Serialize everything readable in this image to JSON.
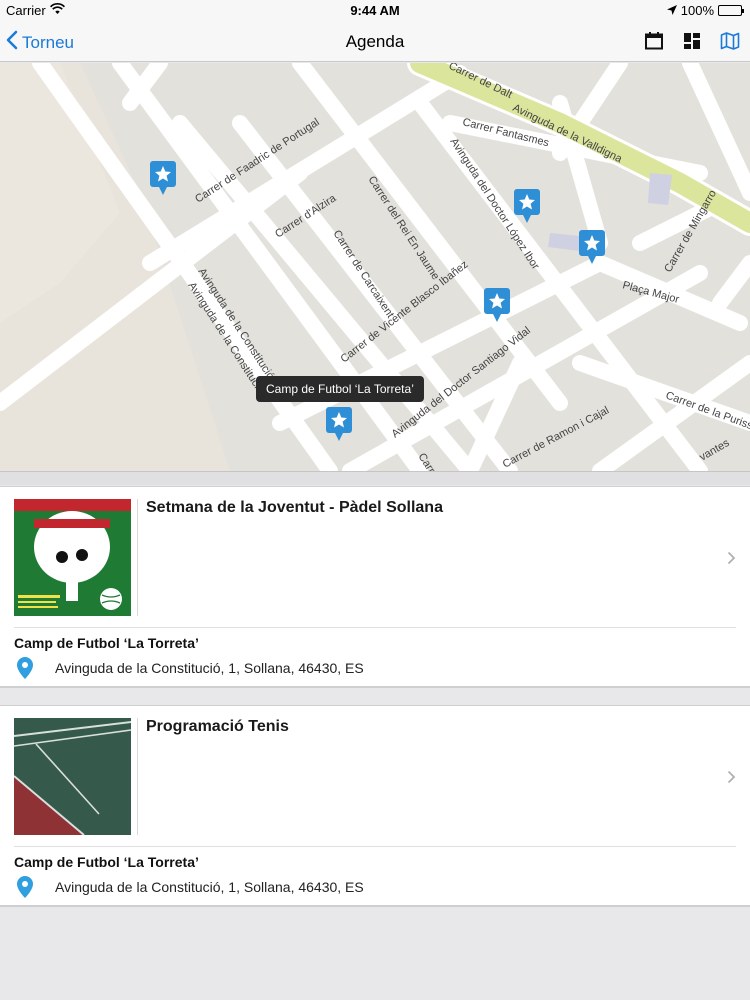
{
  "status": {
    "carrier": "Carrier",
    "time": "9:44 AM",
    "battery": "100%"
  },
  "nav": {
    "back_label": "Torneu",
    "title": "Agenda"
  },
  "map": {
    "callout": "Camp de Futbol ‘La Torreta’",
    "streets": [
      "Carrer de Dalt",
      "Avinguda de la Valldigna",
      "Carrer Fantasmes",
      "Carrer de Faadric de Portugal",
      "Carrer d'Alzira",
      "Carrer del Rei En Jaume",
      "Avinguda del Doctor López Ibor",
      "Carrer de Mingarro",
      "Plaça Major",
      "Carrer de Carcaixent",
      "Avinguda de la Constitució",
      "Avinguda de la Constitució",
      "Carrer de Vicente Blasco Ibañez",
      "Avinguda del Doctor Santiago Vidal",
      "Carrer de Ramon i Cajal",
      "Carrer de la Puriss",
      "Carrer d",
      "vantes"
    ]
  },
  "events": [
    {
      "title": "Setmana de la Joventut - Pàdel Sollana",
      "venue": "Camp de Futbol ‘La Torreta’",
      "address": "Avinguda de la Constitució, 1, Sollana, 46430, ES"
    },
    {
      "title": "Programació Tenis",
      "venue": "Camp de Futbol ‘La Torreta’",
      "address": "Avinguda de la Constitució, 1, Sollana, 46430, ES"
    }
  ],
  "colors": {
    "accent": "#1a7ad8",
    "marker": "#2f8fd6",
    "road_major": "#dbe59c"
  }
}
